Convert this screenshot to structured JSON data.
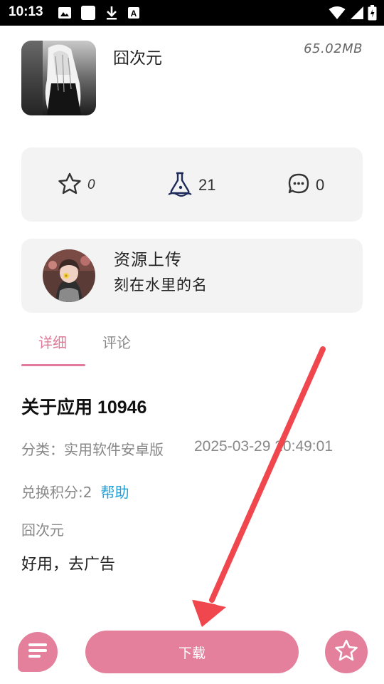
{
  "status_bar": {
    "time": "10:13",
    "left_icons": [
      "image-icon",
      "square-icon",
      "download-icon",
      "font-a-icon"
    ],
    "right_icons": [
      "wifi-icon",
      "signal-icon",
      "battery-icon"
    ]
  },
  "app": {
    "name": "囧次元",
    "size": "65.02MB"
  },
  "stats": {
    "favorites": "0",
    "downloads": "21",
    "comments": "0"
  },
  "uploader": {
    "title": "资源上传",
    "name": "刻在水里的名"
  },
  "tabs": [
    {
      "label": "详细",
      "active": true
    },
    {
      "label": "评论",
      "active": false
    }
  ],
  "detail": {
    "title": "关于应用 10946",
    "category": "分类：实用软件安卓版",
    "date": "2025-03-29 20:49:01",
    "points_label": "兑换积分:2",
    "help_label": "帮助",
    "author": "囧次元",
    "description": "好用，去广告"
  },
  "bottom_bar": {
    "download_label": "下载"
  },
  "colors": {
    "accent": "#e47f9c",
    "tab_active": "#e07b9b",
    "link": "#1ea1db",
    "card_bg": "#f3f3f3",
    "annotation_arrow": "#f0474f"
  }
}
